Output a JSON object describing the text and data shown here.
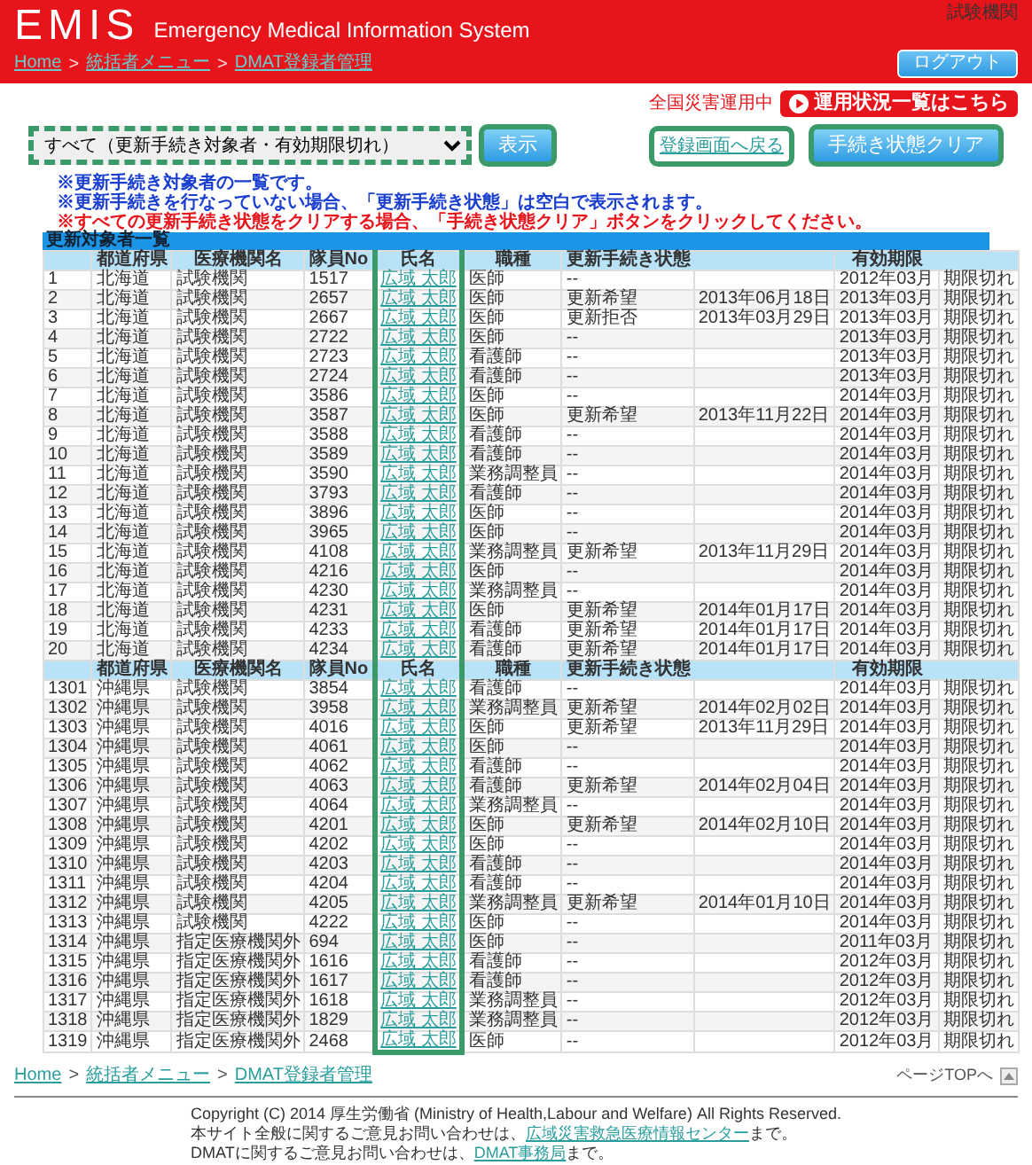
{
  "header": {
    "logo": "EMIS",
    "subtitle": "Emergency Medical Information System",
    "user_label": "試験機関",
    "breadcrumb": {
      "separator": ">",
      "items": [
        "Home",
        "統括者メニュー",
        "DMAT登録者管理"
      ]
    },
    "logout_button": "ログアウト"
  },
  "disaster_status": {
    "label": "全国災害運用中",
    "button": "運用状況一覧はこちら"
  },
  "filter": {
    "select_value": "すべて（更新手続き対象者・有効期限切れ）",
    "highlighted": true
  },
  "show_button": {
    "label": "表示",
    "highlighted": true
  },
  "back_link": {
    "label": "登録画面へ戻る",
    "highlighted": true
  },
  "clear_button": {
    "label": "手続き状態クリア",
    "highlighted": true
  },
  "notes": [
    {
      "kind": "info",
      "text": "※更新手続き対象者の一覧です。"
    },
    {
      "kind": "info",
      "text": "※更新手続きを行なっていない場合、「更新手続き状態」は空白で表示されます。"
    },
    {
      "kind": "warning",
      "text": "※すべての更新手続き状態をクリアする場合、「手続き状態クリア」ボタンをクリックしてください。"
    }
  ],
  "table": {
    "title": "更新対象者一覧",
    "name_column_highlighted": true,
    "rows": [
      {
        "kind": "header",
        "cells": [
          "",
          "都道府県",
          "医療機関名",
          "隊員No",
          "氏名",
          "職種",
          "更新手続き状態",
          "",
          "有効期限",
          ""
        ]
      },
      {
        "kind": "data",
        "cells": [
          "1",
          "北海道",
          "試験機関",
          "1517",
          "広域 太郎",
          "医師",
          "--",
          "",
          "2012年03月",
          "期限切れ"
        ]
      },
      {
        "kind": "data",
        "cells": [
          "2",
          "北海道",
          "試験機関",
          "2657",
          "広域 太郎",
          "医師",
          "更新希望",
          "2013年06月18日",
          "2013年03月",
          "期限切れ"
        ]
      },
      {
        "kind": "data",
        "cells": [
          "3",
          "北海道",
          "試験機関",
          "2667",
          "広域 太郎",
          "医師",
          "更新拒否",
          "2013年03月29日",
          "2013年03月",
          "期限切れ"
        ]
      },
      {
        "kind": "data",
        "cells": [
          "4",
          "北海道",
          "試験機関",
          "2722",
          "広域 太郎",
          "医師",
          "--",
          "",
          "2013年03月",
          "期限切れ"
        ]
      },
      {
        "kind": "data",
        "cells": [
          "5",
          "北海道",
          "試験機関",
          "2723",
          "広域 太郎",
          "看護師",
          "--",
          "",
          "2013年03月",
          "期限切れ"
        ]
      },
      {
        "kind": "data",
        "cells": [
          "6",
          "北海道",
          "試験機関",
          "2724",
          "広域 太郎",
          "看護師",
          "--",
          "",
          "2013年03月",
          "期限切れ"
        ]
      },
      {
        "kind": "data",
        "cells": [
          "7",
          "北海道",
          "試験機関",
          "3586",
          "広域 太郎",
          "医師",
          "--",
          "",
          "2014年03月",
          "期限切れ"
        ]
      },
      {
        "kind": "data",
        "cells": [
          "8",
          "北海道",
          "試験機関",
          "3587",
          "広域 太郎",
          "医師",
          "更新希望",
          "2013年11月22日",
          "2014年03月",
          "期限切れ"
        ]
      },
      {
        "kind": "data",
        "cells": [
          "9",
          "北海道",
          "試験機関",
          "3588",
          "広域 太郎",
          "看護師",
          "--",
          "",
          "2014年03月",
          "期限切れ"
        ]
      },
      {
        "kind": "data",
        "cells": [
          "10",
          "北海道",
          "試験機関",
          "3589",
          "広域 太郎",
          "看護師",
          "--",
          "",
          "2014年03月",
          "期限切れ"
        ]
      },
      {
        "kind": "data",
        "cells": [
          "11",
          "北海道",
          "試験機関",
          "3590",
          "広域 太郎",
          "業務調整員",
          "--",
          "",
          "2014年03月",
          "期限切れ"
        ]
      },
      {
        "kind": "data",
        "cells": [
          "12",
          "北海道",
          "試験機関",
          "3793",
          "広域 太郎",
          "看護師",
          "--",
          "",
          "2014年03月",
          "期限切れ"
        ]
      },
      {
        "kind": "data",
        "cells": [
          "13",
          "北海道",
          "試験機関",
          "3896",
          "広域 太郎",
          "医師",
          "--",
          "",
          "2014年03月",
          "期限切れ"
        ]
      },
      {
        "kind": "data",
        "cells": [
          "14",
          "北海道",
          "試験機関",
          "3965",
          "広域 太郎",
          "医師",
          "--",
          "",
          "2014年03月",
          "期限切れ"
        ]
      },
      {
        "kind": "data",
        "cells": [
          "15",
          "北海道",
          "試験機関",
          "4108",
          "広域 太郎",
          "業務調整員",
          "更新希望",
          "2013年11月29日",
          "2014年03月",
          "期限切れ"
        ]
      },
      {
        "kind": "data",
        "cells": [
          "16",
          "北海道",
          "試験機関",
          "4216",
          "広域 太郎",
          "医師",
          "--",
          "",
          "2014年03月",
          "期限切れ"
        ]
      },
      {
        "kind": "data",
        "cells": [
          "17",
          "北海道",
          "試験機関",
          "4230",
          "広域 太郎",
          "業務調整員",
          "--",
          "",
          "2014年03月",
          "期限切れ"
        ]
      },
      {
        "kind": "data",
        "cells": [
          "18",
          "北海道",
          "試験機関",
          "4231",
          "広域 太郎",
          "医師",
          "更新希望",
          "2014年01月17日",
          "2014年03月",
          "期限切れ"
        ]
      },
      {
        "kind": "data",
        "cells": [
          "19",
          "北海道",
          "試験機関",
          "4233",
          "広域 太郎",
          "看護師",
          "更新希望",
          "2014年01月17日",
          "2014年03月",
          "期限切れ"
        ]
      },
      {
        "kind": "data",
        "cells": [
          "20",
          "北海道",
          "試験機関",
          "4234",
          "広域 太郎",
          "看護師",
          "更新希望",
          "2014年01月17日",
          "2014年03月",
          "期限切れ"
        ]
      },
      {
        "kind": "header",
        "cells": [
          "",
          "都道府県",
          "医療機関名",
          "隊員No",
          "氏名",
          "職種",
          "更新手続き状態",
          "",
          "有効期限",
          ""
        ]
      },
      {
        "kind": "data",
        "cells": [
          "1301",
          "沖縄県",
          "試験機関",
          "3854",
          "広域 太郎",
          "看護師",
          "--",
          "",
          "2014年03月",
          "期限切れ"
        ]
      },
      {
        "kind": "data",
        "cells": [
          "1302",
          "沖縄県",
          "試験機関",
          "3958",
          "広域 太郎",
          "業務調整員",
          "更新希望",
          "2014年02月02日",
          "2014年03月",
          "期限切れ"
        ]
      },
      {
        "kind": "data",
        "cells": [
          "1303",
          "沖縄県",
          "試験機関",
          "4016",
          "広域 太郎",
          "医師",
          "更新希望",
          "2013年11月29日",
          "2014年03月",
          "期限切れ"
        ]
      },
      {
        "kind": "data",
        "cells": [
          "1304",
          "沖縄県",
          "試験機関",
          "4061",
          "広域 太郎",
          "医師",
          "--",
          "",
          "2014年03月",
          "期限切れ"
        ]
      },
      {
        "kind": "data",
        "cells": [
          "1305",
          "沖縄県",
          "試験機関",
          "4062",
          "広域 太郎",
          "看護師",
          "--",
          "",
          "2014年03月",
          "期限切れ"
        ]
      },
      {
        "kind": "data",
        "cells": [
          "1306",
          "沖縄県",
          "試験機関",
          "4063",
          "広域 太郎",
          "看護師",
          "更新希望",
          "2014年02月04日",
          "2014年03月",
          "期限切れ"
        ]
      },
      {
        "kind": "data",
        "cells": [
          "1307",
          "沖縄県",
          "試験機関",
          "4064",
          "広域 太郎",
          "業務調整員",
          "--",
          "",
          "2014年03月",
          "期限切れ"
        ]
      },
      {
        "kind": "data",
        "cells": [
          "1308",
          "沖縄県",
          "試験機関",
          "4201",
          "広域 太郎",
          "医師",
          "更新希望",
          "2014年02月10日",
          "2014年03月",
          "期限切れ"
        ]
      },
      {
        "kind": "data",
        "cells": [
          "1309",
          "沖縄県",
          "試験機関",
          "4202",
          "広域 太郎",
          "医師",
          "--",
          "",
          "2014年03月",
          "期限切れ"
        ]
      },
      {
        "kind": "data",
        "cells": [
          "1310",
          "沖縄県",
          "試験機関",
          "4203",
          "広域 太郎",
          "看護師",
          "--",
          "",
          "2014年03月",
          "期限切れ"
        ]
      },
      {
        "kind": "data",
        "cells": [
          "1311",
          "沖縄県",
          "試験機関",
          "4204",
          "広域 太郎",
          "看護師",
          "--",
          "",
          "2014年03月",
          "期限切れ"
        ]
      },
      {
        "kind": "data",
        "cells": [
          "1312",
          "沖縄県",
          "試験機関",
          "4205",
          "広域 太郎",
          "業務調整員",
          "更新希望",
          "2014年01月10日",
          "2014年03月",
          "期限切れ"
        ]
      },
      {
        "kind": "data",
        "cells": [
          "1313",
          "沖縄県",
          "試験機関",
          "4222",
          "広域 太郎",
          "医師",
          "--",
          "",
          "2014年03月",
          "期限切れ"
        ]
      },
      {
        "kind": "data",
        "cells": [
          "1314",
          "沖縄県",
          "指定医療機関外",
          "694",
          "広域 太郎",
          "医師",
          "--",
          "",
          "2011年03月",
          "期限切れ"
        ]
      },
      {
        "kind": "data",
        "cells": [
          "1315",
          "沖縄県",
          "指定医療機関外",
          "1616",
          "広域 太郎",
          "看護師",
          "--",
          "",
          "2012年03月",
          "期限切れ"
        ]
      },
      {
        "kind": "data",
        "cells": [
          "1316",
          "沖縄県",
          "指定医療機関外",
          "1617",
          "広域 太郎",
          "看護師",
          "--",
          "",
          "2012年03月",
          "期限切れ"
        ]
      },
      {
        "kind": "data",
        "cells": [
          "1317",
          "沖縄県",
          "指定医療機関外",
          "1618",
          "広域 太郎",
          "業務調整員",
          "--",
          "",
          "2012年03月",
          "期限切れ"
        ]
      },
      {
        "kind": "data",
        "cells": [
          "1318",
          "沖縄県",
          "指定医療機関外",
          "1829",
          "広域 太郎",
          "業務調整員",
          "--",
          "",
          "2012年03月",
          "期限切れ"
        ]
      },
      {
        "kind": "data",
        "cells": [
          "1319",
          "沖縄県",
          "指定医療機関外",
          "2468",
          "広域 太郎",
          "医師",
          "--",
          "",
          "2012年03月",
          "期限切れ"
        ]
      }
    ]
  },
  "footer": {
    "breadcrumb": {
      "separator": ">",
      "items": [
        "Home",
        "統括者メニュー",
        "DMAT登録者管理"
      ]
    },
    "page_top": "ページTOPへ",
    "copyright": "Copyright (C) 2014 厚生労働省 (Ministry of Health,Labour and Welfare) All Rights Reserved.",
    "contacts": [
      {
        "before": "本サイト全般に関するご意見お問い合わせは、",
        "link": "広域災害救急医療情報センター",
        "after": "まで。"
      },
      {
        "before": "DMATに関するご意見お問い合わせは、",
        "link": "DMAT事務局",
        "after": "まで。"
      }
    ]
  }
}
